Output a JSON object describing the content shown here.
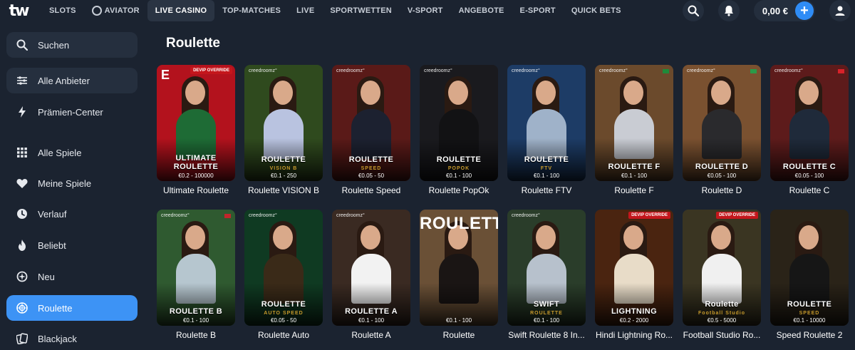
{
  "header": {
    "logo": "tw",
    "nav": [
      {
        "label": "SLOTS",
        "active": false
      },
      {
        "label": "AVIATOR",
        "active": false,
        "icon": "aviator-icon"
      },
      {
        "label": "LIVE CASINO",
        "active": true
      },
      {
        "label": "TOP-MATCHES",
        "active": false
      },
      {
        "label": "LIVE",
        "active": false
      },
      {
        "label": "SPORTWETTEN",
        "active": false
      },
      {
        "label": "V-SPORT",
        "active": false
      },
      {
        "label": "ANGEBOTE",
        "active": false
      },
      {
        "label": "E-SPORT",
        "active": false
      },
      {
        "label": "QUICK BETS",
        "active": false
      }
    ],
    "balance": "0,00 €"
  },
  "sidebar": {
    "items": [
      {
        "label": "Suchen",
        "icon": "search-icon"
      },
      {
        "label": "Alle Anbieter",
        "icon": "sliders-icon"
      },
      {
        "label": "Prämien-Center",
        "icon": "lightning-icon"
      },
      {
        "label": "Alle Spiele",
        "icon": "grid-icon"
      },
      {
        "label": "Meine Spiele",
        "icon": "heart-icon"
      },
      {
        "label": "Verlauf",
        "icon": "clock-icon"
      },
      {
        "label": "Beliebt",
        "icon": "flame-icon"
      },
      {
        "label": "Neu",
        "icon": "sparkle-icon"
      },
      {
        "label": "Roulette",
        "icon": "roulette-icon"
      },
      {
        "label": "Blackjack",
        "icon": "cards-icon"
      }
    ]
  },
  "main": {
    "title": "Roulette",
    "games": [
      {
        "title": "Ultimate Roulette",
        "thumb_name": "ULTIMATE ROULETTE",
        "limits": "€0.2 - 100000",
        "badge": "DEVIP OVERRIDE",
        "corner": "E",
        "bg": "#b3121d",
        "body": "#1e6b35",
        "brand": ""
      },
      {
        "title": "Roulette VISION B",
        "thumb_name": "ROULETTE",
        "sub": "VISION B",
        "limits": "€0.1 - 250",
        "bg": "#2f4a1e",
        "body": "#b9c3e0",
        "brand": "creedroomz°"
      },
      {
        "title": "Roulette Speed",
        "thumb_name": "ROULETTE",
        "sub": "SPEED",
        "limits": "€0.05 - 50",
        "bg": "#5a1a18",
        "body": "#1c2130",
        "brand": "creedroomz°"
      },
      {
        "title": "Roulette PopOk",
        "thumb_name": "ROULETTE",
        "sub": "POPOK",
        "limits": "€0.1 - 100",
        "bg": "#1a1a1e",
        "body": "#121214",
        "brand": "creedroomz°"
      },
      {
        "title": "Roulette FTV",
        "thumb_name": "ROULETTE",
        "sub": "FTV",
        "limits": "€0.1 - 100",
        "bg": "#1d3c66",
        "body": "#9fb2c9",
        "brand": "creedroomz°"
      },
      {
        "title": "Roulette F",
        "thumb_name": "ROULETTE F",
        "limits": "€0.1 - 100",
        "bg": "#6b4a2c",
        "body": "#c9ccd3",
        "brand": "creedroomz°",
        "flag": "#1f8a3a"
      },
      {
        "title": "Roulette D",
        "thumb_name": "ROULETTE D",
        "limits": "€0.05 - 100",
        "bg": "#7a5130",
        "body": "#2a2a2d",
        "brand": "creedroomz°",
        "flag": "#2b9a48"
      },
      {
        "title": "Roulette C",
        "thumb_name": "ROULETTE C",
        "limits": "€0.05 - 100",
        "bg": "#5d1b1b",
        "body": "#1f2a3a",
        "brand": "creedroomz°",
        "flag": "#d8222a"
      },
      {
        "title": "Roulette B",
        "thumb_name": "ROULETTE B",
        "limits": "€0.1 - 100",
        "bg": "#2f5a30",
        "body": "#b6c6cf",
        "brand": "creedroomz°",
        "flag": "#c0262b"
      },
      {
        "title": "Roulette Auto",
        "thumb_name": "ROULETTE",
        "sub": "AUTO SPEED",
        "limits": "€0.05 - 50",
        "bg": "#0f3a22",
        "body": "#3a2a18",
        "brand": "creedroomz°"
      },
      {
        "title": "Roulette A",
        "thumb_name": "ROULETTE A",
        "limits": "€0.1 - 100",
        "bg": "#3a2a22",
        "body": "#f2f2f2",
        "brand": "creedroomz°"
      },
      {
        "title": "Roulette",
        "thumb_name": "",
        "bigword": "ROULETTE",
        "limits": "€0.1 - 100",
        "bg": "#6a5036",
        "body": "#1a1514",
        "brand": ""
      },
      {
        "title": "Swift Roulette 8 In...",
        "thumb_name": "SWIFT",
        "sub": "ROULETTE",
        "limits": "€0.1 - 100",
        "bg": "#2a3d2a",
        "body": "#b7c1cc",
        "brand": "creedroomz°"
      },
      {
        "title": "Hindi Lightning Ro...",
        "thumb_name": "LIGHTNING",
        "limits": "€0.2 - 2000",
        "badge": "DEVIP OVERRIDE",
        "bg": "#4a2410",
        "body": "#e8dcc8",
        "brand": ""
      },
      {
        "title": "Football Studio Ro...",
        "thumb_name": "Roulette",
        "sub": "Football Studio",
        "limits": "€0.5 - 5000",
        "badge": "DEVIP OVERRIDE",
        "bg": "#3a3522",
        "body": "#f0f0f0",
        "brand": ""
      },
      {
        "title": "Speed Roulette 2",
        "thumb_name": "ROULETTE",
        "sub": "SPEED",
        "limits": "€0.1 - 10000",
        "bg": "#2a2318",
        "body": "#161616",
        "brand": ""
      }
    ]
  },
  "colors": {
    "accent": "#3d93f5",
    "background": "#1b2330",
    "panel": "#252f3e"
  }
}
